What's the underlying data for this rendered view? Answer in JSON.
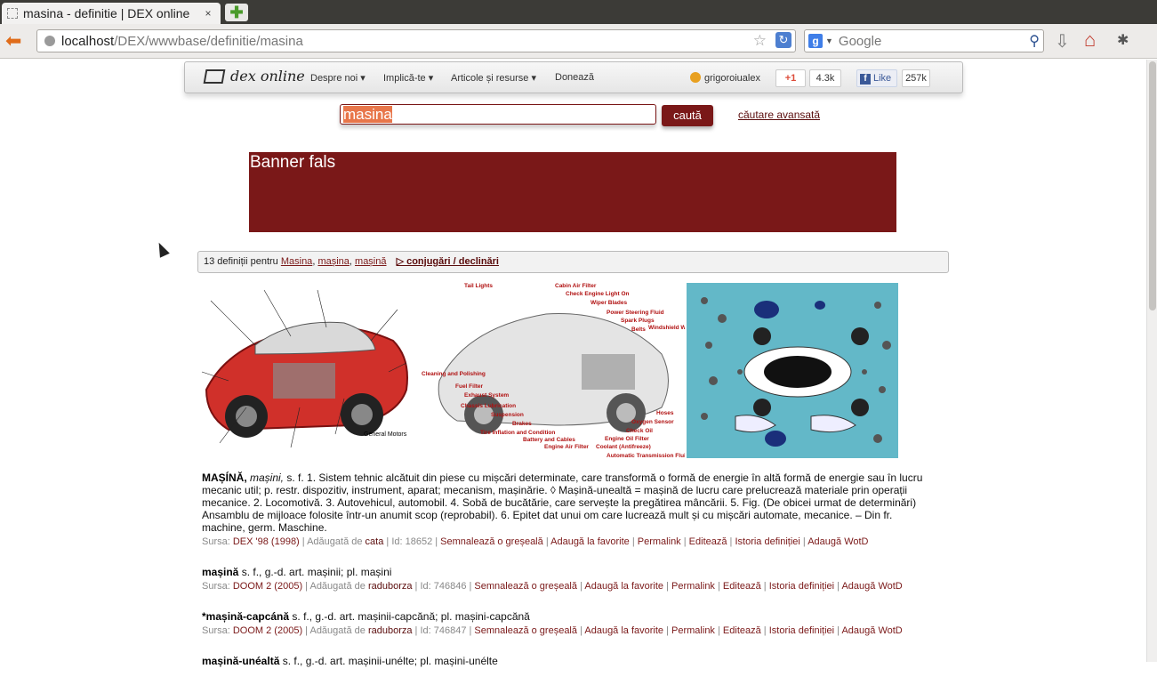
{
  "browser": {
    "tab_title": "masina - definitie | DEX online",
    "tab_close": "×",
    "new_tab": "✚",
    "url_host": "localhost",
    "url_path": "/DEX/wwwbase/definitie/masina",
    "search_engine": "Google",
    "search_placeholder": "Google"
  },
  "site": {
    "logo_text": "dex online",
    "menu": [
      "Despre noi ▾",
      "Implică-te ▾",
      "Articole și resurse ▾",
      "Donează"
    ],
    "username": "grigoroiualex",
    "gplus_label": "+1",
    "gplus_count": "4.3k",
    "fb_label": "Like",
    "fb_count": "257k"
  },
  "search": {
    "value": "masina",
    "button": "caută",
    "advanced": "căutare avansată"
  },
  "banner": {
    "text": "Banner fals"
  },
  "results": {
    "count_text": "13 definiții pentru",
    "links": [
      "Masina",
      "mașina",
      "mașină"
    ],
    "conjugations": "▷ conjugări / declinări"
  },
  "images": {
    "img1_caption": "General Motors",
    "img2_labels": [
      "Tail Lights",
      "Cabin Air Filter",
      "Check Engine Light On",
      "Wiper Blades",
      "Power Steering Fluid",
      "Spark Plugs",
      "Belts",
      "Windshield Washer Lights",
      "Cleaning and Polishing",
      "Fuel Filter",
      "Exhaust System",
      "Chassis Lubrication",
      "Suspension",
      "Brakes",
      "Tire Inflation and Condition",
      "Battery and Cables",
      "Engine Air Filter",
      "Coolant (Antifreeze)",
      "Engine Oil Filter",
      "Check Oil",
      "Oxygen Sensor",
      "Hoses",
      "Automatic Transmission Fluid"
    ]
  },
  "definitions": [
    {
      "headword": "MAȘÍNĂ,",
      "forms": "mașini",
      "body": "s. f. 1. Sistem tehnic alcătuit din piese cu mișcări determinate, care transformă o formă de energie în altă formă de energie sau în lucru mecanic util; p. restr. dispozitiv, instrument, aparat; mecanism, mașinărie. ◊ Mașină-unealtă = mașină de lucru care prelucrează materiale prin operații mecanice. 2. Locomotivă. 3. Autovehicul, automobil. 4. Sobă de bucătărie, care servește la pregătirea mâncării. 5. Fig. (De obicei urmat de determinări) Ansamblu de mijloace folosite într-un anumit scop (reprobabil). 6. Epitet dat unui om care lucrează mult și cu mișcări automate, mecanice. – Din fr. machine, germ. Maschine.",
      "source_label": "Sursa:",
      "source": "DEX '98 (1998)",
      "added_by_label": "| Adăugată de",
      "added_by": "cata",
      "id_text": "| Id: 18652 |",
      "actions": [
        "Semnalează o greșeală",
        "Adaugă la favorite",
        "Permalink",
        "Editează",
        "Istoria definiției",
        "Adaugă WotD"
      ]
    },
    {
      "headword": "mașină",
      "forms": "",
      "body": "s. f., g.-d. art. mașinii; pl. mașini",
      "source_label": "Sursa:",
      "source": "DOOM 2 (2005)",
      "added_by_label": "| Adăugată de",
      "added_by": "raduborza",
      "id_text": "| Id: 746846 |",
      "actions": [
        "Semnalează o greșeală",
        "Adaugă la favorite",
        "Permalink",
        "Editează",
        "Istoria definiției",
        "Adaugă WotD"
      ]
    },
    {
      "headword": "*mașină-capcánă",
      "forms": "",
      "body": "s. f., g.-d. art. mașinii-capcănă; pl. mașini-capcănă",
      "source_label": "Sursa:",
      "source": "DOOM 2 (2005)",
      "added_by_label": "| Adăugată de",
      "added_by": "raduborza",
      "id_text": "| Id: 746847 |",
      "actions": [
        "Semnalează o greșeală",
        "Adaugă la favorite",
        "Permalink",
        "Editează",
        "Istoria definiției",
        "Adaugă WotD"
      ]
    },
    {
      "headword": "mașină-unéaltă",
      "forms": "",
      "body": "s. f., g.-d. art. mașinii-unélte; pl. mașini-unélte",
      "source_label": "",
      "source": "",
      "added_by_label": "",
      "added_by": "",
      "id_text": "",
      "actions": []
    }
  ]
}
